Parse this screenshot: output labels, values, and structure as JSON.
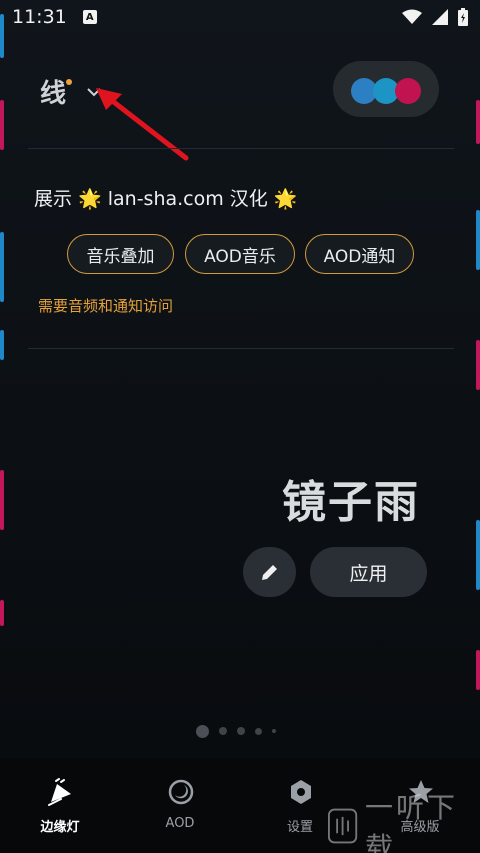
{
  "status_bar": {
    "time": "11:31",
    "badge": "A"
  },
  "header": {
    "title": "线",
    "colors": {
      "accent_dot": "#f0a23a",
      "theme_circles": [
        "#2b7fc2",
        "#1d95c4",
        "#c0134f"
      ]
    }
  },
  "promo": {
    "text": "展示 🌟 lan-sha.com 汉化 🌟"
  },
  "chips": [
    {
      "label": "音乐叠加"
    },
    {
      "label": "AOD音乐"
    },
    {
      "label": "AOD通知"
    }
  ],
  "notice": "需要音频和通知访问",
  "preset": {
    "name": "镜子雨",
    "apply_label": "应用"
  },
  "pager": {
    "pages": 5,
    "current": 1
  },
  "bottom_nav": [
    {
      "label": "边缘灯",
      "icon": "edge-light-icon",
      "active": true
    },
    {
      "label": "AOD",
      "icon": "aod-moon-icon",
      "active": false
    },
    {
      "label": "设置",
      "icon": "settings-gear-icon",
      "active": false
    },
    {
      "label": "高级版",
      "icon": "star-icon",
      "active": false
    }
  ],
  "watermark": {
    "text": "一听下载"
  },
  "colors": {
    "background": "#0b0e12",
    "chip_border": "#d39a3c",
    "notice": "#e6a13a",
    "edge_pink": "#c2185b",
    "edge_blue": "#1e88c8"
  }
}
